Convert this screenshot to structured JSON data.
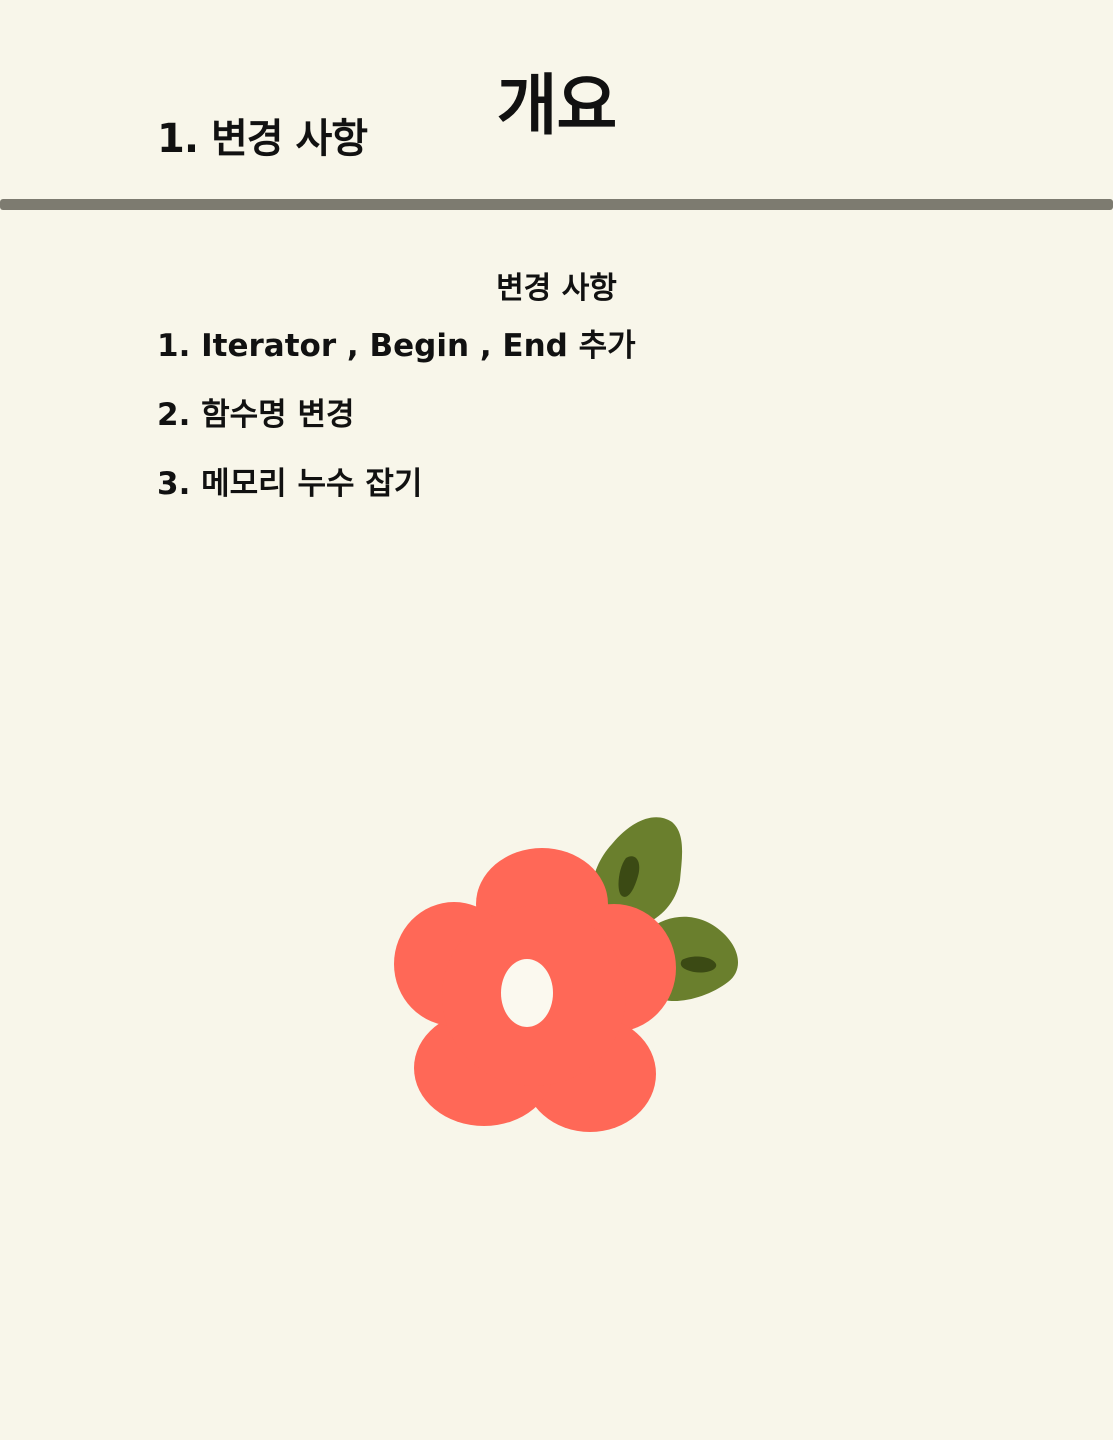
{
  "document": {
    "title": "개요",
    "toc": {
      "item": "1. 변경 사항"
    },
    "section": {
      "heading": "변경 사항",
      "items": [
        "1. Iterator , Begin , End 추가",
        "2. 함수명 변경",
        "3. 메모리 누수 잡기"
      ]
    },
    "illustration": {
      "icon": "flower-icon",
      "petal_color": "#ff6857",
      "leaf_color": "#6a7f2d",
      "leaf_vein_color": "#3b4a14",
      "center_color": "#fbf9ef"
    }
  }
}
